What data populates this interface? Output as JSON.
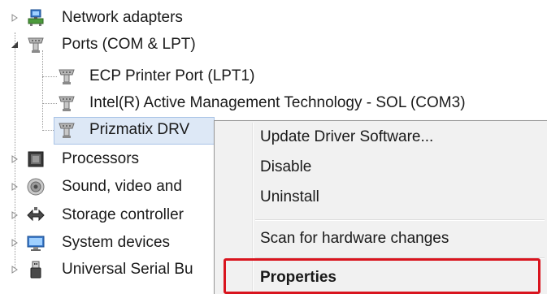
{
  "tree": {
    "items": [
      {
        "label": "Network adapters",
        "icon": "network-adapter-icon",
        "expander": "collapsed"
      },
      {
        "label": "Ports (COM & LPT)",
        "icon": "port-icon",
        "expander": "expanded"
      },
      {
        "label": "ECP Printer Port (LPT1)",
        "icon": "port-icon"
      },
      {
        "label": "Intel(R) Active Management Technology - SOL (COM3)",
        "icon": "port-icon"
      },
      {
        "label": "Prizmatix DRV",
        "icon": "port-icon",
        "selected": true
      },
      {
        "label": "Processors",
        "icon": "processor-icon",
        "expander": "collapsed"
      },
      {
        "label": "Sound, video and",
        "icon": "sound-icon",
        "expander": "collapsed"
      },
      {
        "label": "Storage controller",
        "icon": "storage-controller-icon",
        "expander": "collapsed"
      },
      {
        "label": "System devices",
        "icon": "system-devices-icon",
        "expander": "collapsed"
      },
      {
        "label": "Universal Serial Bu",
        "icon": "usb-icon",
        "expander": "collapsed"
      }
    ]
  },
  "context_menu": {
    "items": [
      {
        "label": "Update Driver Software..."
      },
      {
        "label": "Disable"
      },
      {
        "label": "Uninstall"
      },
      {
        "label": "Scan for hardware changes"
      },
      {
        "label": "Properties",
        "default": true,
        "highlighted": true
      }
    ]
  },
  "colors": {
    "highlight_border": "#d9141e",
    "selection_fill": "#dde8f6",
    "menu_background": "#f1f1f1"
  }
}
